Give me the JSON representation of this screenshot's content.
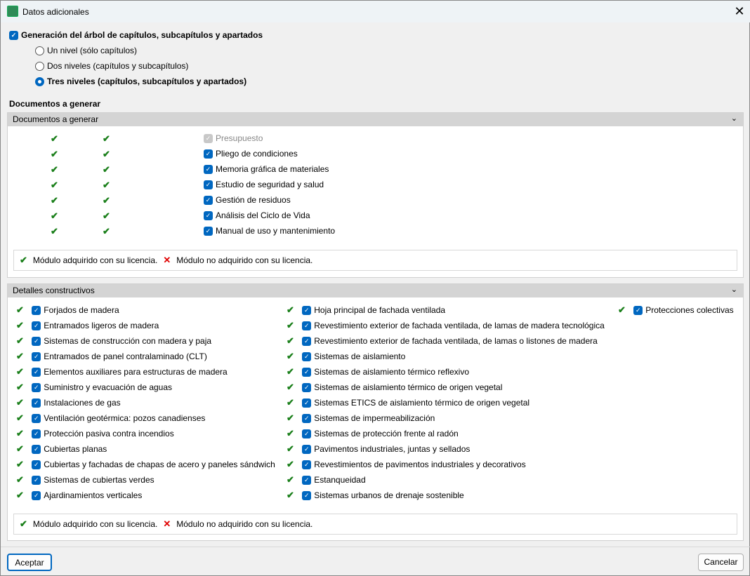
{
  "window": {
    "title": "Datos adicionales"
  },
  "tree": {
    "label": "Generación del árbol de capítulos, subcapítulos y apartados",
    "checked": true,
    "options": [
      {
        "label": "Un nivel (sólo capítulos)",
        "selected": false
      },
      {
        "label": "Dos niveles (capítulos y subcapítulos)",
        "selected": false
      },
      {
        "label": "Tres niveles (capítulos, subcapítulos y apartados)",
        "selected": true
      }
    ]
  },
  "docs_section_label": "Documentos a generar",
  "docs_panel": {
    "title": "Documentos a generar",
    "items": [
      {
        "label": "Presupuesto",
        "disabled": true
      },
      {
        "label": "Pliego de condiciones"
      },
      {
        "label": "Memoria gráfica de materiales"
      },
      {
        "label": "Estudio de seguridad y salud"
      },
      {
        "label": "Gestión de residuos"
      },
      {
        "label": "Análisis del Ciclo de Vida"
      },
      {
        "label": "Manual de uso y mantenimiento"
      }
    ]
  },
  "legend": {
    "acquired": "Módulo adquirido con su licencia.",
    "not_acquired": "Módulo no adquirido con su licencia."
  },
  "details_panel": {
    "title": "Detalles constructivos",
    "columns": [
      [
        "Forjados de madera",
        "Entramados ligeros de madera",
        "Sistemas de construcción con madera y paja",
        "Entramados de panel contralaminado (CLT)",
        "Elementos auxiliares para estructuras de madera",
        "Suministro y evacuación de aguas",
        "Instalaciones de gas",
        "Ventilación geotérmica: pozos canadienses",
        "Protección pasiva contra incendios",
        "Cubiertas planas",
        "Cubiertas y fachadas de chapas de acero y paneles sándwich",
        "Sistemas de cubiertas verdes",
        "Ajardinamientos verticales"
      ],
      [
        "Hoja principal de fachada ventilada",
        "Revestimiento exterior de fachada ventilada, de lamas de madera tecnológica",
        "Revestimiento exterior de fachada ventilada, de lamas o listones de madera",
        "Sistemas de aislamiento",
        "Sistemas de aislamiento térmico reflexivo",
        "Sistemas de aislamiento térmico de origen vegetal",
        "Sistemas ETICS de aislamiento térmico de origen vegetal",
        "Sistemas de impermeabilización",
        "Sistemas de protección frente al radón",
        "Pavimentos industriales, juntas y sellados",
        "Revestimientos de pavimentos industriales y decorativos",
        "Estanqueidad",
        "Sistemas urbanos de drenaje sostenible"
      ],
      [
        "Protecciones colectivas"
      ]
    ]
  },
  "buttons": {
    "accept": "Aceptar",
    "cancel": "Cancelar"
  }
}
